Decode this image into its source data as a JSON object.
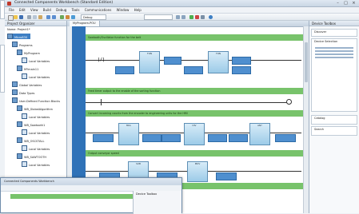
{
  "window": {
    "title": "Connected Components Workbench (Standard Edition)",
    "min_icon": "minimize-icon",
    "max_icon": "maximize-icon",
    "close_icon": "close-icon"
  },
  "menu": [
    "File",
    "Edit",
    "View",
    "Build",
    "Debug",
    "Tools",
    "Communications",
    "Window",
    "Help"
  ],
  "toolbar": {
    "mode_combo": "Debug",
    "target_combo": ""
  },
  "project_organizer": {
    "title": "Project Organizer",
    "project_label": "Name: Project1*",
    "items": [
      {
        "label": "Micro830",
        "level": 0,
        "selected": true
      },
      {
        "label": "Programs",
        "level": 1
      },
      {
        "label": "MyProgram",
        "level": 2
      },
      {
        "label": "Local Variables",
        "level": 3
      },
      {
        "label": "MYmain11",
        "level": 2
      },
      {
        "label": "Local Variables",
        "level": 3
      },
      {
        "label": "Global Variables",
        "level": 1
      },
      {
        "label": "Data Types",
        "level": 1
      },
      {
        "label": "User-Defined Function Blocks",
        "level": 1
      },
      {
        "label": "WB_GlobalAlgorithm",
        "level": 2
      },
      {
        "label": "Local Variables",
        "level": 3
      },
      {
        "label": "WB_Sawtooth1",
        "level": 2
      },
      {
        "label": "Local Variables",
        "level": 3
      },
      {
        "label": "WB_OSCSTALL",
        "level": 2
      },
      {
        "label": "Local Variables",
        "level": 3
      },
      {
        "label": "WB_SAWTOOTH",
        "level": 2
      },
      {
        "label": "Local Variables",
        "level": 3
      }
    ]
  },
  "editor": {
    "tab": "MyProgram-POU",
    "rungs": [
      {
        "comment": "Sawtooth/Oscillator function for the belt"
      },
      {
        "comment": "Feed timer output to the enable of the sorting function"
      },
      {
        "comment": "Convert incoming counts from the encoder to engineering units for the HMI"
      },
      {
        "comment": "Output conveyor speed"
      }
    ],
    "contact_1": "|/|"
  },
  "right_panel": {
    "title": "Device Toolbox",
    "sub_title": "Discover",
    "tree_title": "Device Selection",
    "lower_title": "Catalog",
    "search_label": "Search"
  },
  "front_window": {
    "title": "Connected Components Workbench",
    "side_title": "Device Toolbox"
  }
}
